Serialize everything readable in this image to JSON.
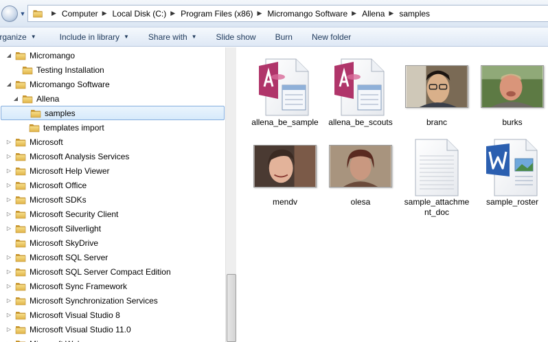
{
  "address_bar": {
    "crumbs": [
      "Computer",
      "Local Disk (C:)",
      "Program Files (x86)",
      "Micromango Software",
      "Allena",
      "samples"
    ]
  },
  "toolbar": {
    "organize_label": "Organize",
    "include_label": "Include in library",
    "share_label": "Share with",
    "slideshow_label": "Slide show",
    "burn_label": "Burn",
    "newfolder_label": "New folder"
  },
  "nav_tree": {
    "items": [
      {
        "label": "Micromango",
        "expander": "open",
        "level": 1
      },
      {
        "label": "Testing Installation",
        "expander": "none",
        "level": 2
      },
      {
        "label": "Micromango Software",
        "expander": "open",
        "level": 1
      },
      {
        "label": "Allena",
        "expander": "open",
        "level": 2
      },
      {
        "label": "samples",
        "expander": "none",
        "level": 3,
        "selected": true
      },
      {
        "label": "templates import",
        "expander": "none",
        "level": 3
      },
      {
        "label": "Microsoft",
        "expander": "closed",
        "level": 1
      },
      {
        "label": "Microsoft Analysis Services",
        "expander": "closed",
        "level": 1
      },
      {
        "label": "Microsoft Help Viewer",
        "expander": "closed",
        "level": 1
      },
      {
        "label": "Microsoft Office",
        "expander": "closed",
        "level": 1
      },
      {
        "label": "Microsoft SDKs",
        "expander": "closed",
        "level": 1
      },
      {
        "label": "Microsoft Security Client",
        "expander": "closed",
        "level": 1
      },
      {
        "label": "Microsoft Silverlight",
        "expander": "closed",
        "level": 1
      },
      {
        "label": "Microsoft SkyDrive",
        "expander": "none",
        "level": 1
      },
      {
        "label": "Microsoft SQL Server",
        "expander": "closed",
        "level": 1
      },
      {
        "label": "Microsoft SQL Server Compact Edition",
        "expander": "closed",
        "level": 1
      },
      {
        "label": "Microsoft Sync Framework",
        "expander": "closed",
        "level": 1
      },
      {
        "label": "Microsoft Synchronization Services",
        "expander": "closed",
        "level": 1
      },
      {
        "label": "Microsoft Visual Studio 8",
        "expander": "closed",
        "level": 1
      },
      {
        "label": "Microsoft Visual Studio 11.0",
        "expander": "closed",
        "level": 1
      },
      {
        "label": "Microsoft Web",
        "expander": "closed",
        "level": 1
      }
    ]
  },
  "files": [
    {
      "name": "allena_be_sample",
      "kind": "access-db-icon"
    },
    {
      "name": "allena_be_scouts",
      "kind": "access-db-icon"
    },
    {
      "name": "branc",
      "kind": "photo-thumbnail"
    },
    {
      "name": "burks",
      "kind": "photo-thumbnail"
    },
    {
      "name": "mendv",
      "kind": "photo-thumbnail"
    },
    {
      "name": "olesa",
      "kind": "photo-thumbnail"
    },
    {
      "name": "sample_attachment_doc",
      "kind": "text-document-icon"
    },
    {
      "name": "sample_roster",
      "kind": "word-document-icon"
    }
  ],
  "colors": {
    "selection_border": "#84acdd",
    "toolbar_text": "#1e395b",
    "folder_yellow": "#e9c25a",
    "access_accent": "#b0356a",
    "word_blue": "#2b5fb0"
  }
}
